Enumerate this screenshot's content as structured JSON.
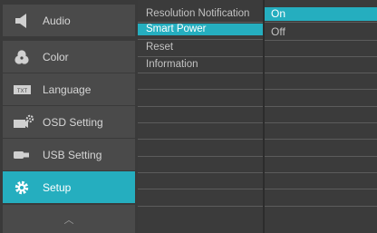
{
  "menu": {
    "items": [
      {
        "label": "Audio",
        "icon": "speaker-icon"
      },
      {
        "label": "Color",
        "icon": "color-circles-icon"
      },
      {
        "label": "Language",
        "icon": "txt-icon",
        "icon_text": "TXT"
      },
      {
        "label": "OSD Setting",
        "icon": "osd-gear-icon"
      },
      {
        "label": "USB Setting",
        "icon": "usb-icon"
      },
      {
        "label": "Setup",
        "icon": "gear-icon"
      }
    ],
    "up_glyph": "︿"
  },
  "submenu": {
    "items": [
      "Resolution Notification",
      "Smart Power",
      "Reset",
      "Information"
    ]
  },
  "options": {
    "items": [
      "On",
      "Off"
    ]
  },
  "colors": {
    "accent": "#25aebf",
    "menu_item_bg": "#4a4a4a",
    "panel_bg": "#3b3b3b",
    "text": "#c2c2c2"
  }
}
